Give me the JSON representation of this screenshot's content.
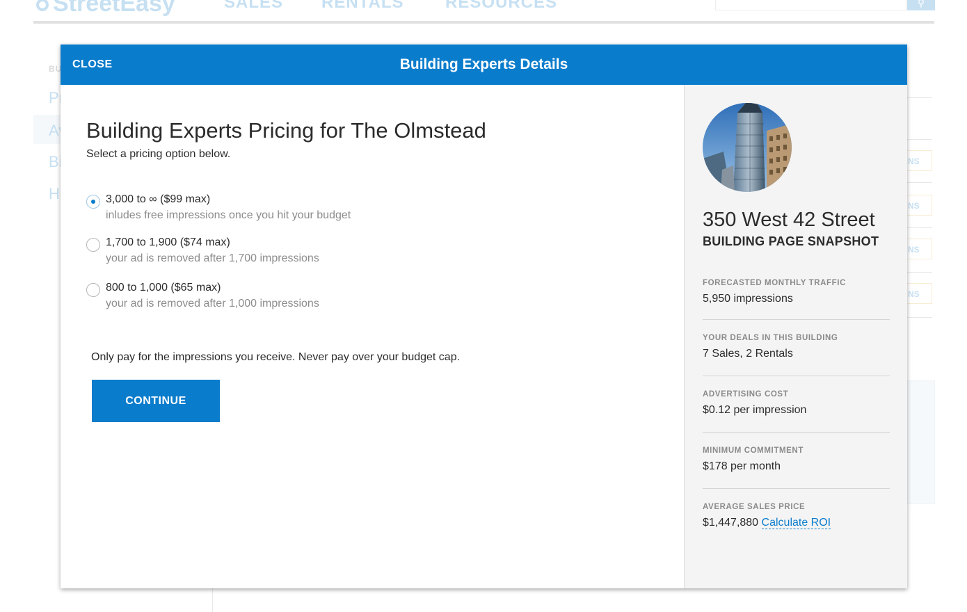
{
  "background": {
    "logo": "StreetEasy",
    "nav": [
      "SALES",
      "RENTALS",
      "RESOURCES"
    ],
    "side_items": [
      "BU",
      "Pr",
      "Av",
      "Bi",
      "Ho"
    ],
    "side_buttons": [
      "NS",
      "NS",
      "NS",
      "NS"
    ]
  },
  "modal": {
    "close_label": "CLOSE",
    "title": "Building Experts Details"
  },
  "main": {
    "heading": "Building Experts Pricing for The Olmstead",
    "subheading": "Select a pricing option below.",
    "options": [
      {
        "label": "3,000 to ∞ ($99 max)",
        "description": "inludes free impressions once you hit your budget",
        "selected": true
      },
      {
        "label": "1,700 to 1,900 ($74 max)",
        "description": "your ad is removed after 1,700 impressions",
        "selected": false
      },
      {
        "label": "800 to 1,000 ($65 max)",
        "description": "your ad is removed after 1,000 impressions",
        "selected": false
      }
    ],
    "note": "Only pay for the impressions you receive.  Never pay over your budget cap.",
    "continue_label": "CONTINUE"
  },
  "sidebar": {
    "address": "350 West 42 Street",
    "snapshot_title": "BUILDING PAGE SNAPSHOT",
    "stats": [
      {
        "label": "FORECASTED MONTHLY TRAFFIC",
        "value": "5,950 impressions"
      },
      {
        "label": "YOUR DEALS IN THIS BUILDING",
        "value": "7 Sales, 2 Rentals"
      },
      {
        "label": "ADVERTISING COST",
        "value": "$0.12 per impression"
      },
      {
        "label": "MINIMUM COMMITMENT",
        "value": "$178 per month"
      },
      {
        "label": "AVERAGE SALES PRICE",
        "value": "$1,447,880",
        "link": "Calculate ROI"
      }
    ]
  },
  "colors": {
    "brand_blue": "#0a7ccc",
    "text_dark": "#2b2b2b",
    "text_muted": "#8c8c8c",
    "sidebar_bg": "#f4f4f4"
  }
}
